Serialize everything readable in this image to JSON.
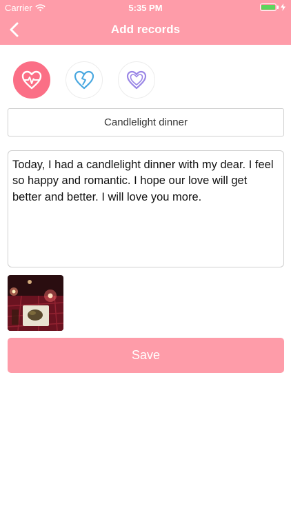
{
  "status_bar": {
    "carrier": "Carrier",
    "time": "5:35 PM"
  },
  "nav": {
    "title": "Add records",
    "back_icon": "chevron-left-icon"
  },
  "moods": [
    {
      "icon": "heartbeat-icon",
      "selected": true
    },
    {
      "icon": "broken-heart-icon",
      "selected": false
    },
    {
      "icon": "heart-outline-icon",
      "selected": false
    }
  ],
  "form": {
    "title_value": "Candlelight dinner",
    "content_value": "Today, I had a candlelight dinner with my dear. I feel so happy and romantic. I hope our love will get better and better. I will love you more.",
    "photo": "candlelight-dinner-photo"
  },
  "save_label": "Save",
  "colors": {
    "accent": "#fe9ca9",
    "selected_mood": "#fb6f86",
    "broken_heart": "#4aa8e0",
    "heart_outline": "#9a86e6"
  }
}
